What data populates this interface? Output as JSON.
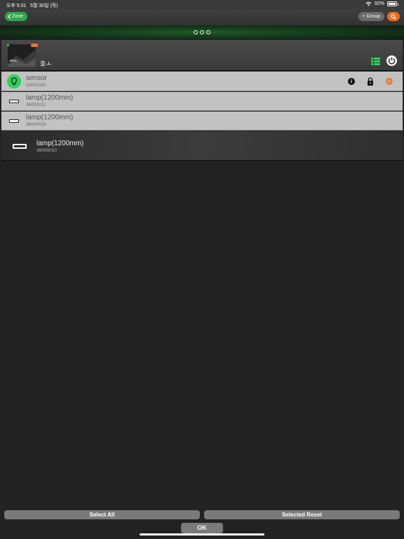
{
  "statusbar": {
    "time": "오후 5:31",
    "date": "5월 30일 (목)",
    "battery": "92%",
    "battery_level": 0.92
  },
  "nav": {
    "zone_label": "Zone",
    "group_label": "+ Group"
  },
  "zone": {
    "name": "호ㅗ",
    "badge": "1"
  },
  "devices": [
    {
      "name": "sensor",
      "serial": "10001001"
    },
    {
      "name": "lamp(1200mm)",
      "serial": "36000011"
    },
    {
      "name": "lamp(1200mm)",
      "serial": "36000029"
    },
    {
      "name": "lamp(1200mm)",
      "serial": "36000010"
    }
  ],
  "footer": {
    "select_all": "Select All",
    "selected_reset": "Selected Reset",
    "ok": "OK"
  },
  "colors": {
    "accent_green": "#2fa84a",
    "accent_orange": "#f26a1b",
    "sensor_green": "#2fd15a"
  }
}
